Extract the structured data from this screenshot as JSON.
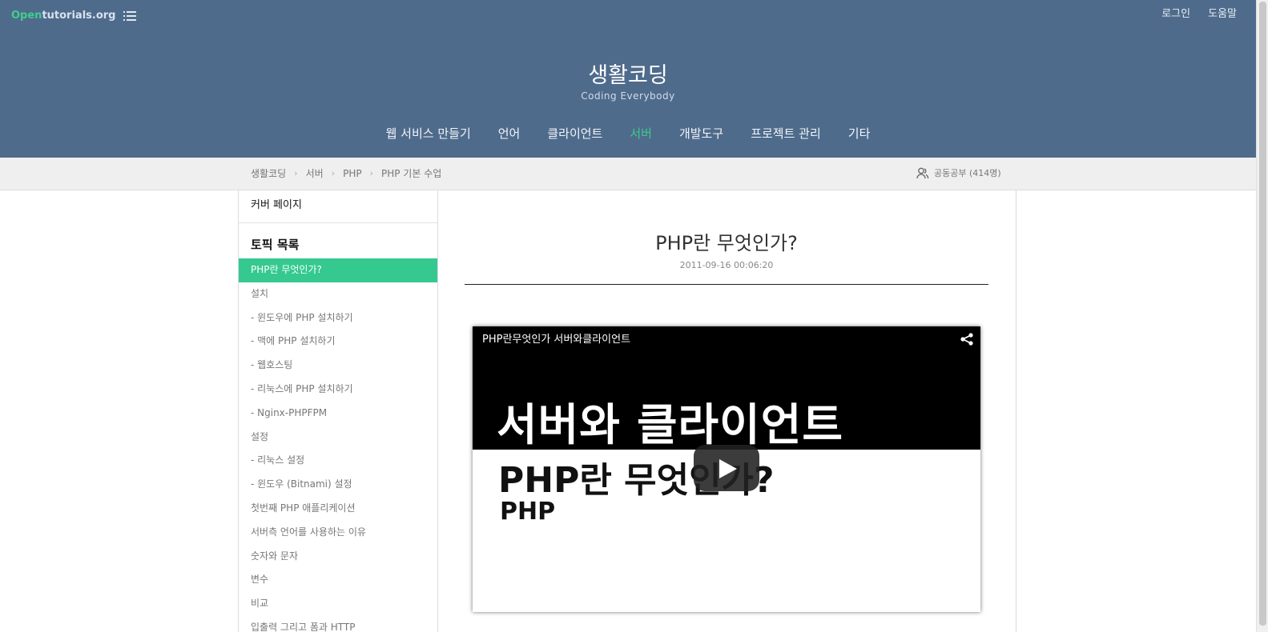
{
  "header": {
    "logo_open": "Open",
    "logo_rest": "tutorials.org",
    "login": "로그인",
    "help": "도움말",
    "site_title": "생활코딩",
    "site_subtitle": "Coding Everybody",
    "nav": [
      "웹 서비스 만들기",
      "언어",
      "클라이언트",
      "서버",
      "개발도구",
      "프로젝트 관리",
      "기타"
    ],
    "nav_active": "서버"
  },
  "breadcrumb": {
    "items": [
      "생활코딩",
      "서버",
      "PHP",
      "PHP 기본 수업"
    ],
    "study": "공동공부 (414명)"
  },
  "sidebar": {
    "cover": "커버 페이지",
    "toc_title": "토픽 목록",
    "items": [
      "PHP란 무엇인가?",
      "설치",
      "- 윈도우에 PHP 설치하기",
      "- 맥에 PHP 설치하기",
      "- 웹호스팅",
      "- 리눅스에 PHP 설치하기",
      "- Nginx-PHPFPM",
      "설정",
      "- 리눅스 설정",
      "- 윈도우 (Bitnami) 설정",
      "첫번째 PHP 애플리케이션",
      "서버측 언어를 사용하는 이유",
      "숫자와 문자",
      "변수",
      "비교",
      "입출력 그리고 폼과 HTTP"
    ],
    "active_index": 0
  },
  "content": {
    "title": "PHP란 무엇인가?",
    "date": "2011-09-16 00:06:20",
    "video": {
      "name": "PHP란무엇인가 서버와클라이언트",
      "line1": "서버와 클라이언트",
      "line2": "PHP란 무엇인가?",
      "line3": "PHP"
    }
  },
  "colors": {
    "header_bg": "#4f6b8c",
    "accent": "#35c990"
  },
  "icons": [
    "menu-icon",
    "chevron-right-icon",
    "users-icon",
    "share-icon",
    "play-icon"
  ]
}
